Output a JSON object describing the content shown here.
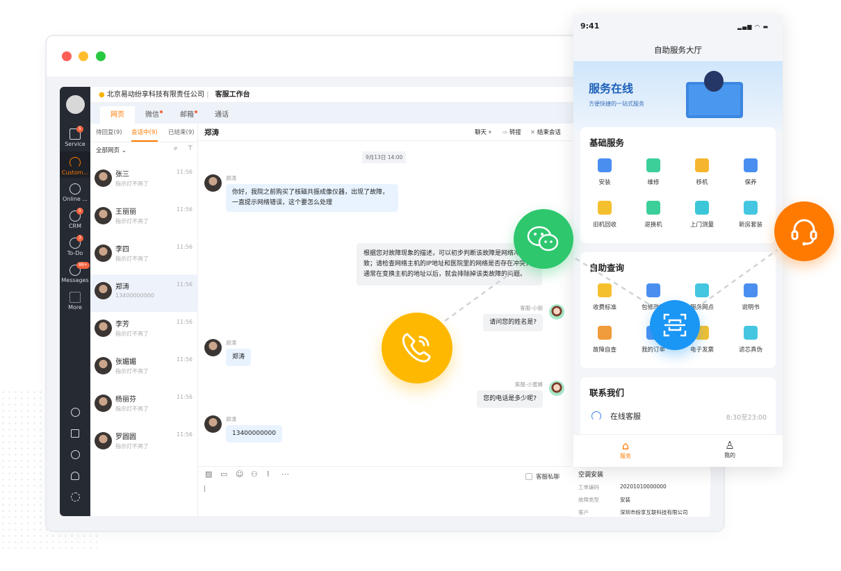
{
  "window": {
    "dots": [
      "#ff5f57",
      "#ffbd2e",
      "#28c840"
    ]
  },
  "header": {
    "company": "北京易动纷享科技有限责任公司",
    "separator": "|",
    "workspace": "客服工作台"
  },
  "channel_tabs": [
    {
      "label": "网页",
      "active": true,
      "dot": false
    },
    {
      "label": "微信",
      "dot": true
    },
    {
      "label": "邮箱",
      "dot": true
    },
    {
      "label": "通话",
      "dot": false
    }
  ],
  "sidebar": {
    "items": [
      {
        "label": "Service",
        "badge": "5",
        "icon": "service-icon"
      },
      {
        "label": "Custom...",
        "active": true,
        "icon": "headset-icon"
      },
      {
        "label": "Online ...",
        "icon": "chat-icon"
      },
      {
        "label": "CRM",
        "badge": "5",
        "icon": "pie-chart-icon"
      },
      {
        "label": "To-Do",
        "badge": "3",
        "icon": "check-circle-icon"
      },
      {
        "label": "Messages",
        "badge": "99+",
        "icon": "message-icon"
      },
      {
        "label": "More",
        "icon": "grid-icon"
      }
    ],
    "bottom_icons": [
      "help-icon",
      "monitor-icon",
      "clock-icon",
      "contacts-icon",
      "settings-icon"
    ]
  },
  "session_tabs": [
    {
      "label": "待回复(9)"
    },
    {
      "label": "会话中(9)",
      "active": true
    },
    {
      "label": "已结束(9)"
    }
  ],
  "filter": {
    "label": "全部网页"
  },
  "conversations": [
    {
      "name": "张三",
      "time": "11:56",
      "preview": "指示灯不亮了"
    },
    {
      "name": "王丽丽",
      "time": "11:56",
      "preview": "指示灯不亮了"
    },
    {
      "name": "李四",
      "time": "11:56",
      "preview": "指示灯不亮了"
    },
    {
      "name": "郑涛",
      "time": "11:56",
      "preview": "13400000000",
      "active": true
    },
    {
      "name": "李芳",
      "time": "11:56",
      "preview": "指示灯不亮了"
    },
    {
      "name": "张媚媚",
      "time": "11:56",
      "preview": "指示灯不亮了"
    },
    {
      "name": "杨丽芬",
      "time": "11:56",
      "preview": "指示灯不亮了"
    },
    {
      "name": "罗圆圆",
      "time": "11:56",
      "preview": "指示灯不亮了"
    }
  ],
  "chat": {
    "title": "郑涛",
    "mode": "聊天",
    "transfer": "转接",
    "end": "结束会话",
    "date": "9月13日 14:00",
    "messages": [
      {
        "sender": "郑涛",
        "text": "你好，我院之前购买了核磁共振成像仪器，出现了故障，一直提示网络错误，这个要怎么处理",
        "dir": "in"
      },
      {
        "sender": "",
        "text": "根据您对故障现象的描述，可以初步判断该故障是网络冲突导致；请检查网络主机的IP地址和医院里的网络是否存在冲突，通常在变换主机的地址以后，就会排除掉该类故障的问题。",
        "dir": "out"
      },
      {
        "sender": "客服-小丽",
        "text": "请问您的姓名是?",
        "dir": "out"
      },
      {
        "sender": "郑涛",
        "text": "郑涛",
        "dir": "in"
      },
      {
        "sender": "客服-小蜜蜂",
        "text": "您的电话是多少呢?",
        "dir": "out"
      },
      {
        "sender": "郑涛",
        "text": "13400000000",
        "dir": "in"
      }
    ],
    "toolbar": [
      "image-icon",
      "screenshot-icon",
      "emoji-icon",
      "user-transfer-icon",
      "attachment-icon",
      "more-icon"
    ],
    "private_label": "客服私聊"
  },
  "phone": {
    "time": "9:41",
    "title": "自助服务大厅",
    "banner_title": "服务在线",
    "banner_subtitle": "方便快捷的一站式服务",
    "basic": {
      "title": "基础服务",
      "items": [
        "安装",
        "维修",
        "移机",
        "保养",
        "旧机回收",
        "退换机",
        "上门测量",
        "新房套装"
      ]
    },
    "query": {
      "title": "自助查询",
      "items": [
        "收费标准",
        "包修政策",
        "服务网点",
        "说明书",
        "故障自查",
        "我的订单",
        "电子发票",
        "滤芯真伪"
      ]
    },
    "contact": {
      "title": "联系我们",
      "service": "在线客服",
      "hours": "8:30至23:00"
    },
    "tabbar": [
      {
        "label": "服务",
        "active": true
      },
      {
        "label": "我的"
      }
    ]
  },
  "detail": {
    "title": "空调安装",
    "rows": [
      {
        "k": "工单编码",
        "v": "20201010000000"
      },
      {
        "k": "故障类型",
        "v": "安装"
      },
      {
        "k": "客户",
        "v": "深圳市纷享互联科技有限公司"
      }
    ]
  },
  "colors": {
    "accent": "#ff7a00",
    "wechat": "#2ec76e",
    "phone": "#ffb800",
    "scan": "#1a96f5",
    "headset": "#ff7a00",
    "sidebar": "#262a33"
  }
}
